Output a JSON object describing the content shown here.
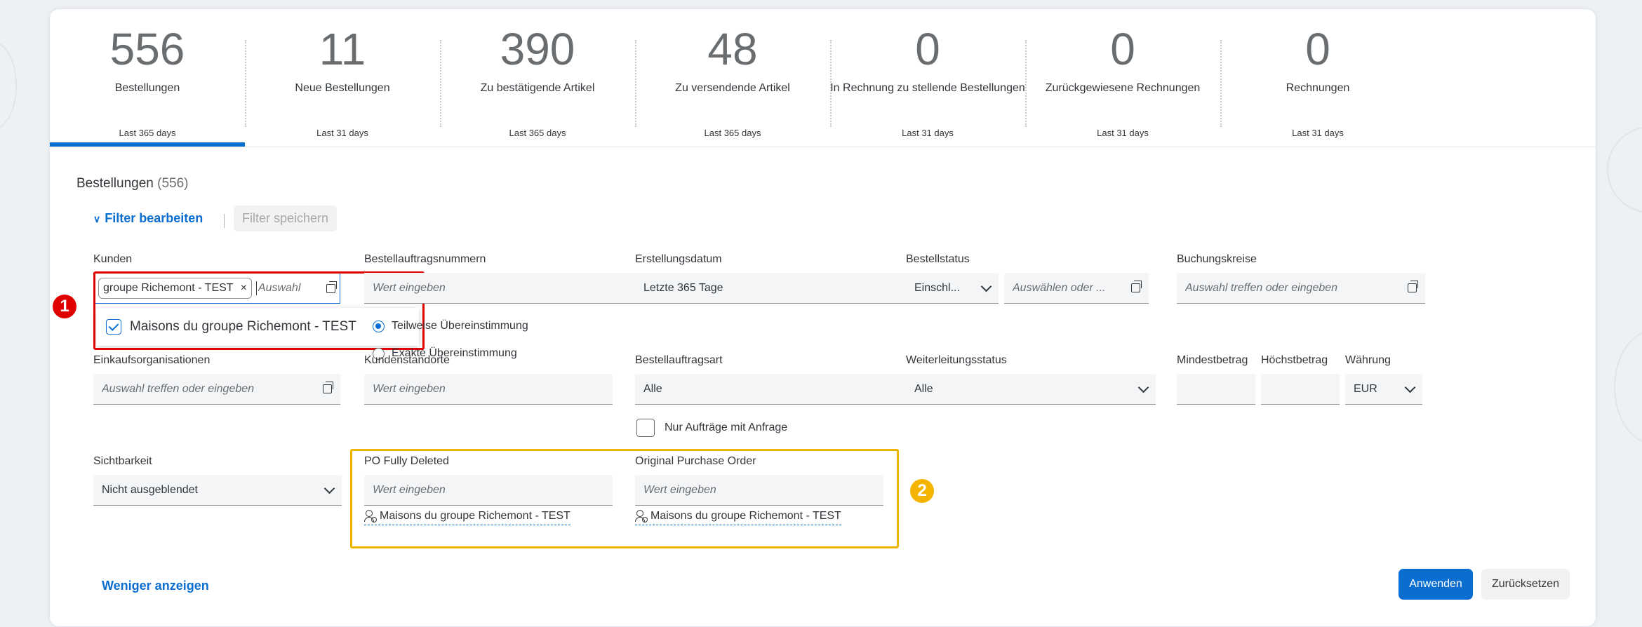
{
  "kpis": [
    {
      "value": "556",
      "label": "Bestellungen",
      "period": "Last 365 days"
    },
    {
      "value": "11",
      "label": "Neue Bestellungen",
      "period": "Last 31 days"
    },
    {
      "value": "390",
      "label": "Zu bestätigende Artikel",
      "period": "Last 365 days"
    },
    {
      "value": "48",
      "label": "Zu versendende Artikel",
      "period": "Last 365 days"
    },
    {
      "value": "0",
      "label": "In Rechnung zu stellende Bestellungen",
      "period": "Last 31 days"
    },
    {
      "value": "0",
      "label": "Zurückgewiesene Rechnungen",
      "period": "Last 31 days"
    },
    {
      "value": "0",
      "label": "Rechnungen",
      "period": "Last 31 days"
    }
  ],
  "section": {
    "title": "Bestellungen",
    "count": "(556)"
  },
  "toolbar": {
    "edit_filter": "Filter bearbeiten",
    "save_filter": "Filter speichern"
  },
  "filters": {
    "kunden": {
      "label": "Kunden",
      "token": "groupe Richemont - TEST",
      "placeholder": "Auswahl",
      "option": "Maisons du groupe Richemont - TEST"
    },
    "bestellauftragsnummern": {
      "label": "Bestellauftragsnummern",
      "placeholder": "Wert eingeben",
      "partial": "Teilweise Übereinstimmung",
      "exact": "Exakte Übereinstimmung"
    },
    "erstellungsdatum": {
      "label": "Erstellungsdatum",
      "value": "Letzte 365 Tage"
    },
    "bestellstatus": {
      "label": "Bestellstatus",
      "value": "Einschl...",
      "placeholder": "Auswählen oder ..."
    },
    "buchungskreise": {
      "label": "Buchungskreise",
      "placeholder": "Auswahl treffen oder eingeben"
    },
    "einkaufsorganisationen": {
      "label": "Einkaufsorganisationen",
      "placeholder": "Auswahl treffen oder eingeben"
    },
    "kundenstandorte": {
      "label": "Kundenstandorte",
      "placeholder": "Wert eingeben"
    },
    "bestellauftragsart": {
      "label": "Bestellauftragsart",
      "value": "Alle",
      "checkbox": "Nur Aufträge mit Anfrage"
    },
    "weiterleitungsstatus": {
      "label": "Weiterleitungsstatus",
      "value": "Alle"
    },
    "mindestbetrag": {
      "label": "Mindestbetrag"
    },
    "hoechstbetrag": {
      "label": "Höchstbetrag"
    },
    "waehrung": {
      "label": "Währung",
      "value": "EUR"
    },
    "sichtbarkeit": {
      "label": "Sichtbarkeit",
      "value": "Nicht ausgeblendet"
    },
    "po_fully_deleted": {
      "label": "PO Fully Deleted",
      "placeholder": "Wert eingeben",
      "mapping": "Maisons du groupe Richemont - TEST"
    },
    "original_po": {
      "label": "Original Purchase Order",
      "placeholder": "Wert eingeben",
      "mapping": "Maisons du groupe Richemont - TEST"
    }
  },
  "badges": {
    "one": "1",
    "two": "2"
  },
  "footer": {
    "show_less": "Weniger anzeigen",
    "apply": "Anwenden",
    "reset": "Zurücksetzen"
  },
  "colors": {
    "accent": "#0a6ed1",
    "highlight_red": "#e00000",
    "highlight_yellow": "#f0b400"
  }
}
